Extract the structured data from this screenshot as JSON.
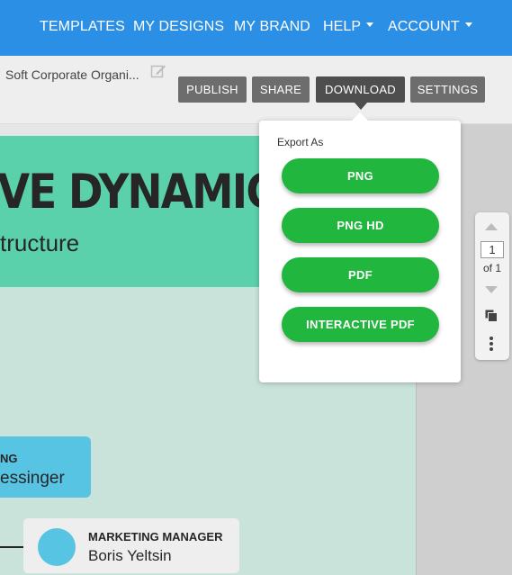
{
  "nav": {
    "templates": "TEMPLATES",
    "my_designs": "MY DESIGNS",
    "my_brand": "MY BRAND",
    "help": "HELP",
    "account": "ACCOUNT"
  },
  "toolbar": {
    "doc_title": "Soft Corporate Organi...",
    "publish": "PUBLISH",
    "share": "SHARE",
    "download": "DOWNLOAD",
    "settings": "SETTINGS"
  },
  "canvas": {
    "hero_title": "VE DYNAMIC",
    "hero_subtitle": "tructure",
    "card1_role": "NG",
    "card1_name": "essinger",
    "card2_role": "MARKETING MANAGER",
    "card2_name": "Boris Yeltsin"
  },
  "pager": {
    "current_page": "1",
    "of_total": "of 1"
  },
  "export_menu": {
    "label": "Export As",
    "options": [
      "PNG",
      "PNG HD",
      "PDF",
      "INTERACTIVE PDF"
    ]
  },
  "colors": {
    "nav_bg": "#2b8fe6",
    "hero_bg": "#5ad1aa",
    "page_bg": "#c9e3da",
    "card_blue": "#58c4e4",
    "export_button": "#21b63e",
    "toolbar_button": "#6d6d6d"
  },
  "icons": {
    "edit": "edit-icon",
    "copy": "copy-page-icon",
    "more": "more-vertical-icon"
  }
}
